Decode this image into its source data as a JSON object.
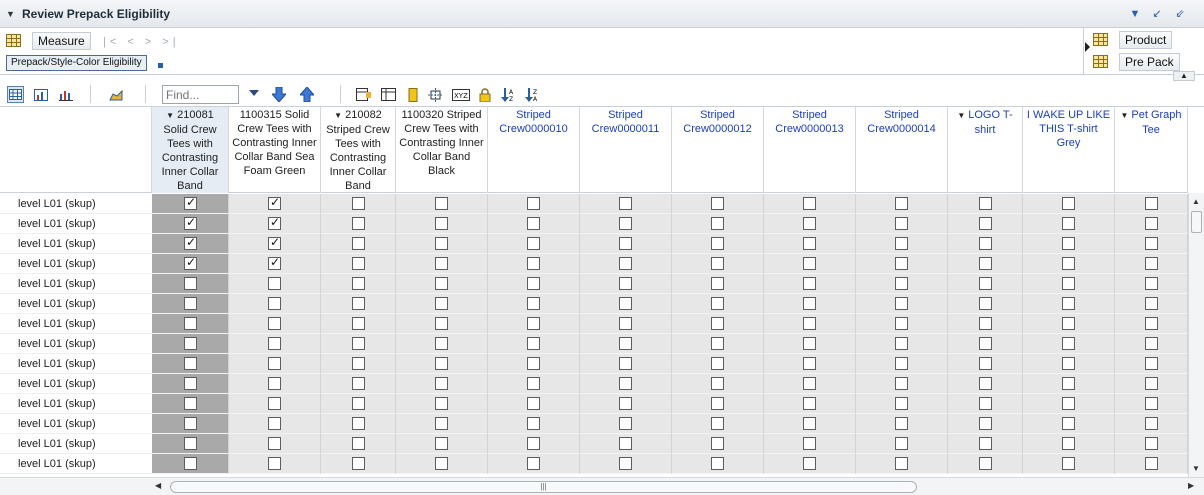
{
  "panel": {
    "title": "Review Prepack Eligibility"
  },
  "layout": {
    "measure_label": "Measure",
    "nav_arrows": "|< < > >|",
    "row_dimension_label": "Prepack/Style-Color Eligibility",
    "column_dims": [
      "Product",
      "Pre Pack"
    ]
  },
  "toolbar": {
    "find_placeholder": "Find..."
  },
  "columns": [
    {
      "label": "210081 Solid Crew Tees with Contrasting Inner Collar Band",
      "expandable": true,
      "link": false,
      "selected": true
    },
    {
      "label": "1100315 Solid Crew Tees with Contrasting Inner Collar Band Sea Foam Green",
      "expandable": false,
      "link": false,
      "selected": false
    },
    {
      "label": "210082 Striped Crew Tees with Contrasting Inner Collar Band",
      "expandable": true,
      "link": false,
      "selected": false
    },
    {
      "label": "1100320 Striped Crew Tees with Contrasting Inner Collar Band Black",
      "expandable": false,
      "link": false,
      "selected": false
    },
    {
      "label": "Striped Crew0000010",
      "expandable": false,
      "link": true,
      "selected": false
    },
    {
      "label": "Striped Crew0000011",
      "expandable": false,
      "link": true,
      "selected": false
    },
    {
      "label": "Striped Crew0000012",
      "expandable": false,
      "link": true,
      "selected": false
    },
    {
      "label": "Striped Crew0000013",
      "expandable": false,
      "link": true,
      "selected": false
    },
    {
      "label": "Striped Crew0000014",
      "expandable": false,
      "link": true,
      "selected": false
    },
    {
      "label": "LOGO T-shirt",
      "expandable": true,
      "link": true,
      "selected": false
    },
    {
      "label": "I WAKE UP LIKE THIS T-shirt Grey",
      "expandable": false,
      "link": true,
      "selected": false
    },
    {
      "label": "Pet Graph Tee",
      "expandable": true,
      "link": true,
      "selected": false
    }
  ],
  "row_label": "level L01 (skup)",
  "rows": [
    [
      true,
      true,
      false,
      false,
      false,
      false,
      false,
      false,
      false,
      false,
      false,
      false
    ],
    [
      true,
      true,
      false,
      false,
      false,
      false,
      false,
      false,
      false,
      false,
      false,
      false
    ],
    [
      true,
      true,
      false,
      false,
      false,
      false,
      false,
      false,
      false,
      false,
      false,
      false
    ],
    [
      true,
      true,
      false,
      false,
      false,
      false,
      false,
      false,
      false,
      false,
      false,
      false
    ],
    [
      false,
      false,
      false,
      false,
      false,
      false,
      false,
      false,
      false,
      false,
      false,
      false
    ],
    [
      false,
      false,
      false,
      false,
      false,
      false,
      false,
      false,
      false,
      false,
      false,
      false
    ],
    [
      false,
      false,
      false,
      false,
      false,
      false,
      false,
      false,
      false,
      false,
      false,
      false
    ],
    [
      false,
      false,
      false,
      false,
      false,
      false,
      false,
      false,
      false,
      false,
      false,
      false
    ],
    [
      false,
      false,
      false,
      false,
      false,
      false,
      false,
      false,
      false,
      false,
      false,
      false
    ],
    [
      false,
      false,
      false,
      false,
      false,
      false,
      false,
      false,
      false,
      false,
      false,
      false
    ],
    [
      false,
      false,
      false,
      false,
      false,
      false,
      false,
      false,
      false,
      false,
      false,
      false
    ],
    [
      false,
      false,
      false,
      false,
      false,
      false,
      false,
      false,
      false,
      false,
      false,
      false
    ],
    [
      false,
      false,
      false,
      false,
      false,
      false,
      false,
      false,
      false,
      false,
      false,
      false
    ],
    [
      false,
      false,
      false,
      false,
      false,
      false,
      false,
      false,
      false,
      false,
      false,
      false
    ]
  ]
}
